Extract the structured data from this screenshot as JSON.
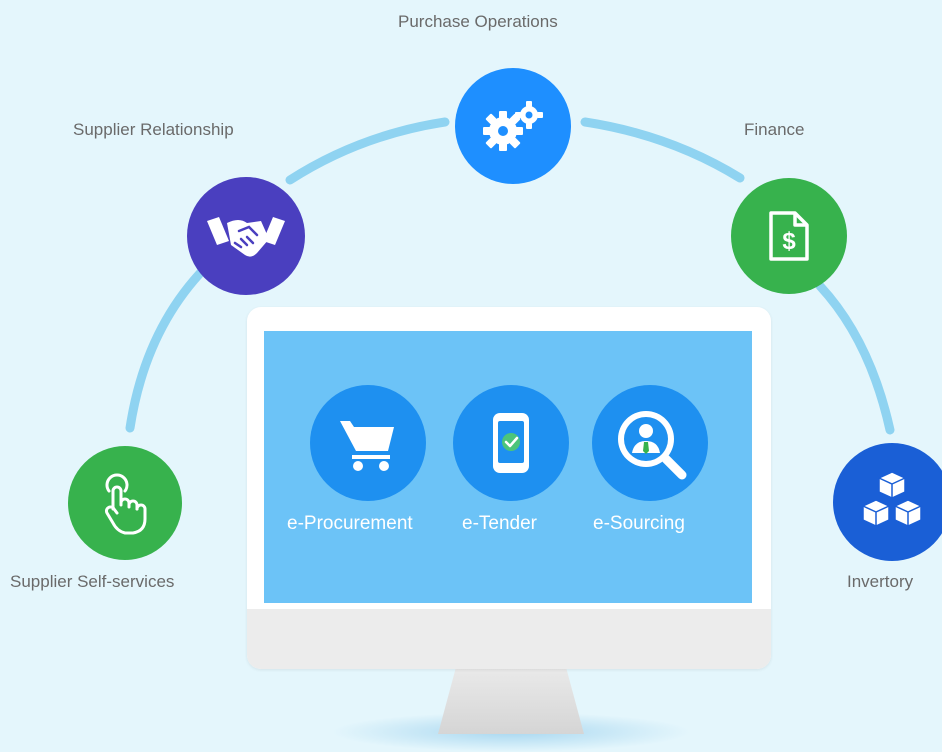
{
  "diagram": {
    "hub_apps": [
      {
        "label": "e-Procurement",
        "icon": "shopping-cart-icon",
        "color": "#1e90f0"
      },
      {
        "label": "e-Tender",
        "icon": "mobile-check-icon",
        "color": "#1e90f0"
      },
      {
        "label": "e-Sourcing",
        "icon": "search-user-icon",
        "color": "#1e90f0"
      }
    ],
    "modules": [
      {
        "label": "Supplier Self-services",
        "icon": "touch-hand-icon",
        "color": "#37b24d"
      },
      {
        "label": "Supplier Relationship",
        "icon": "handshake-icon",
        "color": "#4a3fbf"
      },
      {
        "label": "Purchase Operations",
        "icon": "gears-icon",
        "color": "#1e8fff"
      },
      {
        "label": "Finance",
        "icon": "dollar-document-icon",
        "color": "#37b24d"
      },
      {
        "label": "Invertory",
        "icon": "boxes-icon",
        "color": "#1a5fd6"
      }
    ],
    "arc_color": "#8fd3f1"
  }
}
